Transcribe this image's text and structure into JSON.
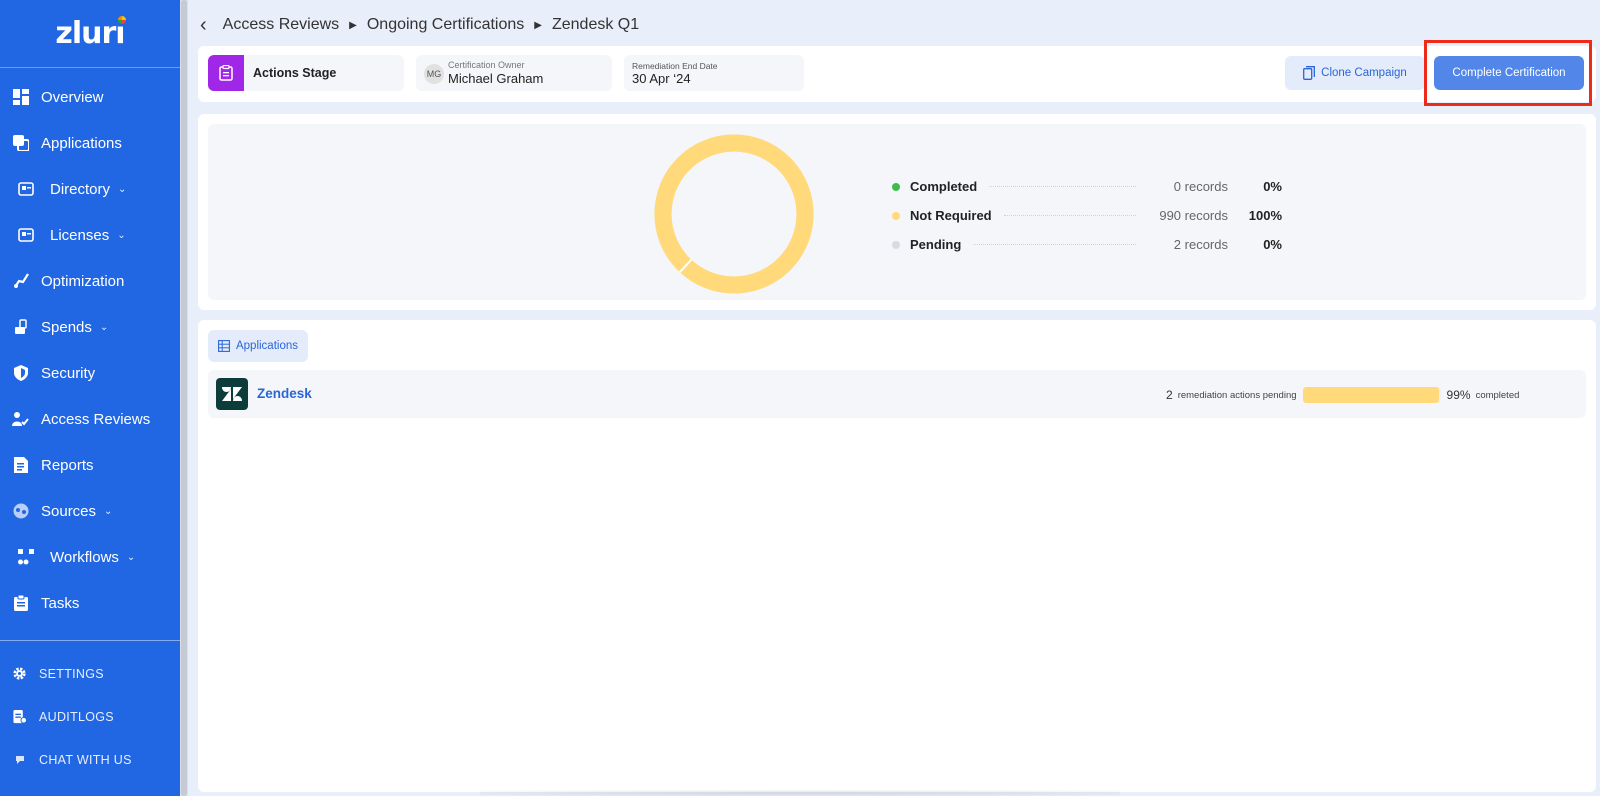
{
  "sidebar": {
    "logo": "zluri",
    "items": [
      {
        "label": "Overview",
        "icon": "overview-icon"
      },
      {
        "label": "Applications",
        "icon": "applications-icon"
      },
      {
        "label": "Directory",
        "icon": "directory-icon"
      },
      {
        "label": "Licenses",
        "icon": "licenses-icon"
      },
      {
        "label": "Optimization",
        "icon": "optimization-icon"
      },
      {
        "label": "Spends",
        "icon": "spends-icon"
      },
      {
        "label": "Security",
        "icon": "security-icon"
      },
      {
        "label": "Access Reviews",
        "icon": "access-reviews-icon"
      },
      {
        "label": "Reports",
        "icon": "reports-icon"
      },
      {
        "label": "Sources",
        "icon": "sources-icon"
      },
      {
        "label": "Workflows",
        "icon": "workflows-icon"
      },
      {
        "label": "Tasks",
        "icon": "tasks-icon"
      }
    ],
    "bottom": [
      {
        "label": "SETTINGS",
        "icon": "gear-icon"
      },
      {
        "label": "AUDITLOGS",
        "icon": "audit-log-icon"
      },
      {
        "label": "CHAT WITH US",
        "icon": "chat-icon"
      }
    ]
  },
  "breadcrumb": [
    "Access Reviews",
    "Ongoing Certifications",
    "Zendesk Q1"
  ],
  "header": {
    "stage_label": "Actions Stage",
    "owner_caption": "Certification Owner",
    "owner_initials": "MG",
    "owner_name": "Michael Graham",
    "date_caption": "Remediation End Date",
    "date_value": "30 Apr ‘24",
    "clone_label": "Clone Campaign",
    "complete_label": "Complete Certification"
  },
  "summary": {
    "legend": [
      {
        "label": "Completed",
        "records": "0 records",
        "percent": "0%",
        "color": "#3dbb4d"
      },
      {
        "label": "Not Required",
        "records": "990 records",
        "percent": "100%",
        "color": "#ffd97a"
      },
      {
        "label": "Pending",
        "records": "2 records",
        "percent": "0%",
        "color": "#d7dbe2"
      }
    ]
  },
  "chart_data": {
    "type": "pie",
    "categories": [
      "Completed",
      "Not Required",
      "Pending"
    ],
    "values": [
      0,
      990,
      2
    ]
  },
  "apps": {
    "tab_label": "Applications",
    "rows": [
      {
        "name": "Zendesk",
        "pending_count": "2",
        "pending_text": "remediation actions pending",
        "progress": 0.99,
        "percent": "99%",
        "completed_text": "completed"
      }
    ]
  },
  "colors": {
    "sidebar": "#2166e3",
    "accent": "#5286e8",
    "highlight": "#ee2a1a",
    "stage": "#a127e8"
  }
}
